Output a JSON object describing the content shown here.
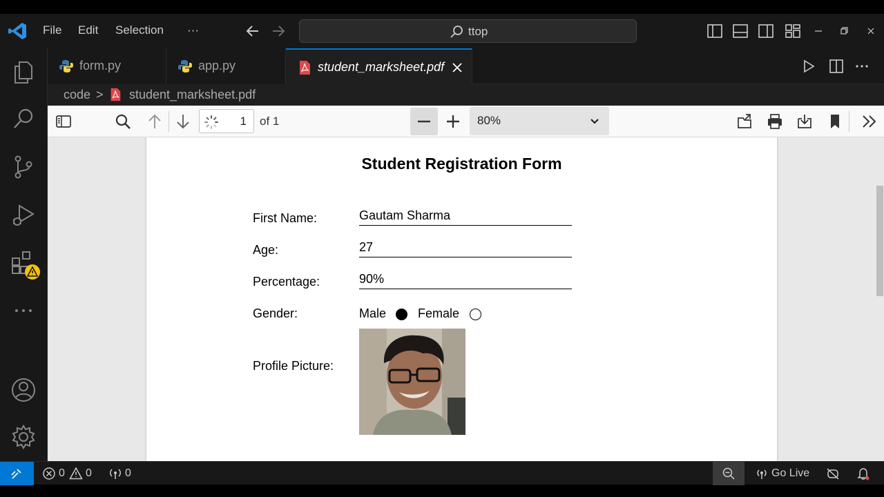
{
  "colors": {
    "accent": "#0078d4",
    "pdf_icon": "#e04848",
    "python_blue": "#3c78aa",
    "python_yellow": "#f7d34a",
    "warning": "#f4c20d"
  },
  "menu": {
    "file": "File",
    "edit": "Edit",
    "selection": "Selection",
    "more": "···"
  },
  "command_center": {
    "text": "ttop",
    "icon": "search-icon"
  },
  "tabs": [
    {
      "label": "form.py",
      "icon": "python-icon"
    },
    {
      "label": "app.py",
      "icon": "python-icon"
    },
    {
      "label": "student_marksheet.pdf",
      "icon": "pdf-icon"
    }
  ],
  "breadcrumb": {
    "folder": "code",
    "separator": ">",
    "file": "student_marksheet.pdf"
  },
  "pdf_toolbar": {
    "page_number": "1",
    "page_of": "of 1",
    "zoom": "80%"
  },
  "document": {
    "title": "Student Registration Form",
    "fields": [
      {
        "label": "First Name:",
        "value": "Gautam Sharma"
      },
      {
        "label": "Age:",
        "value": "27"
      },
      {
        "label": "Percentage:",
        "value": "90%"
      }
    ],
    "gender": {
      "label": "Gender:",
      "option_male": "Male",
      "option_female": "Female",
      "selected": "Male"
    },
    "profile_picture": {
      "label": "Profile Picture:"
    }
  },
  "statusbar": {
    "errors": "0",
    "warnings": "0",
    "ports": "0",
    "go_live": "Go Live"
  }
}
